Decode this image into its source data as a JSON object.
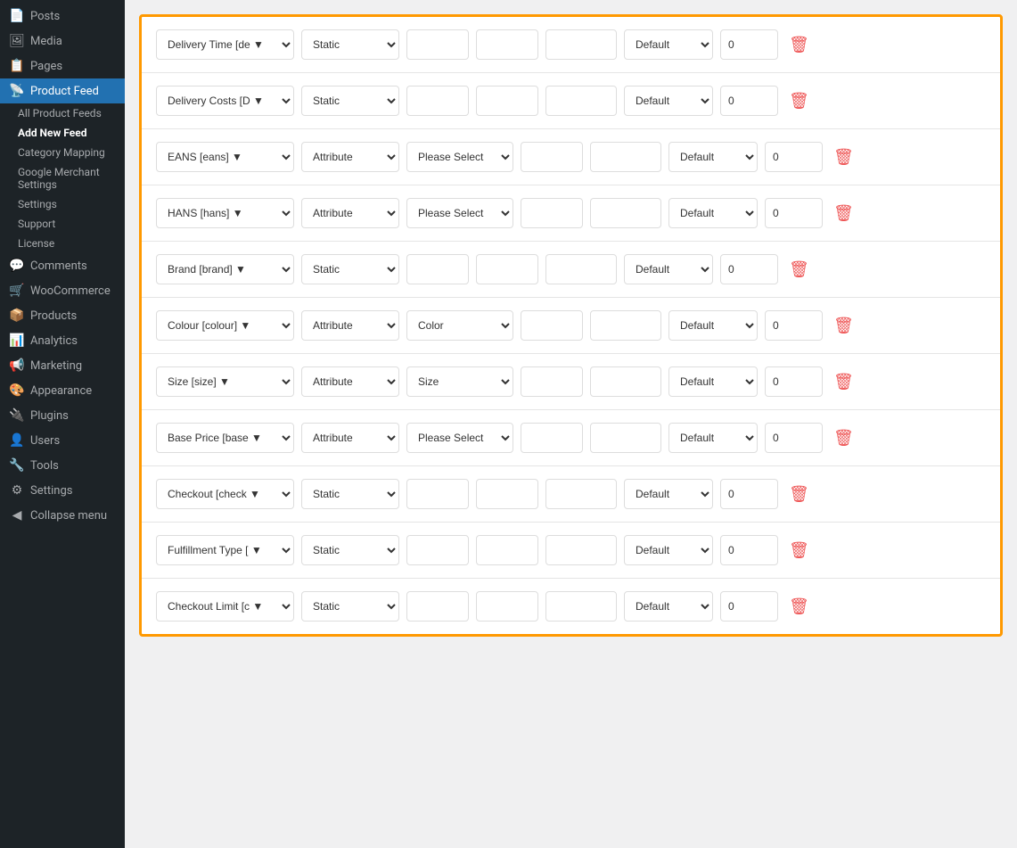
{
  "sidebar": {
    "items": [
      {
        "id": "posts",
        "label": "Posts",
        "icon": "📄"
      },
      {
        "id": "media",
        "label": "Media",
        "icon": "🖼"
      },
      {
        "id": "pages",
        "label": "Pages",
        "icon": "📋"
      },
      {
        "id": "product-feed",
        "label": "Product Feed",
        "icon": "📡",
        "active": true
      },
      {
        "id": "comments",
        "label": "Comments",
        "icon": "💬"
      },
      {
        "id": "woocommerce",
        "label": "WooCommerce",
        "icon": "🛒"
      },
      {
        "id": "products",
        "label": "Products",
        "icon": "📦"
      },
      {
        "id": "analytics",
        "label": "Analytics",
        "icon": "📊"
      },
      {
        "id": "marketing",
        "label": "Marketing",
        "icon": "📢"
      },
      {
        "id": "appearance",
        "label": "Appearance",
        "icon": "🎨"
      },
      {
        "id": "plugins",
        "label": "Plugins",
        "icon": "🔌"
      },
      {
        "id": "users",
        "label": "Users",
        "icon": "👤"
      },
      {
        "id": "tools",
        "label": "Tools",
        "icon": "🔧"
      },
      {
        "id": "settings",
        "label": "Settings",
        "icon": "⚙"
      },
      {
        "id": "collapse",
        "label": "Collapse menu",
        "icon": "◀"
      }
    ],
    "submenu": [
      {
        "id": "all-feeds",
        "label": "All Product Feeds"
      },
      {
        "id": "add-new",
        "label": "Add New Feed",
        "bold": true
      },
      {
        "id": "category",
        "label": "Category Mapping"
      },
      {
        "id": "google",
        "label": "Google Merchant Settings"
      },
      {
        "id": "settings-sub",
        "label": "Settings"
      },
      {
        "id": "support",
        "label": "Support"
      },
      {
        "id": "license",
        "label": "License"
      }
    ]
  },
  "rows": [
    {
      "id": "delivery-time",
      "fieldName": "Delivery Time [de",
      "type": "Static",
      "valueSelect": "",
      "input1": "",
      "input2": "",
      "default": "Default",
      "number": "0"
    },
    {
      "id": "delivery-costs",
      "fieldName": "Delivery Costs [D",
      "type": "Static",
      "valueSelect": "",
      "input1": "",
      "input2": "",
      "default": "Default",
      "number": "0"
    },
    {
      "id": "eans",
      "fieldName": "EANS [eans]",
      "type": "Attribute",
      "valueSelect": "Please Select",
      "input1": "",
      "input2": "",
      "default": "Default",
      "number": "0"
    },
    {
      "id": "hans",
      "fieldName": "HANS [hans]",
      "type": "Attribute",
      "valueSelect": "Please Select",
      "input1": "",
      "input2": "",
      "default": "Default",
      "number": "0"
    },
    {
      "id": "brand",
      "fieldName": "Brand [brand]",
      "type": "Static",
      "valueSelect": "",
      "input1": "",
      "input2": "",
      "default": "Default",
      "number": "0"
    },
    {
      "id": "colour",
      "fieldName": "Colour [colour]",
      "type": "Attribute",
      "valueSelect": "Color",
      "input1": "",
      "input2": "",
      "default": "Default",
      "number": "0"
    },
    {
      "id": "size",
      "fieldName": "Size [size]",
      "type": "Attribute",
      "valueSelect": "Size",
      "input1": "",
      "input2": "",
      "default": "Default",
      "number": "0"
    },
    {
      "id": "base-price",
      "fieldName": "Base Price [base",
      "type": "Attribute",
      "valueSelect": "Please Select",
      "input1": "",
      "input2": "",
      "default": "Default",
      "number": "0"
    },
    {
      "id": "checkout",
      "fieldName": "Checkout [check",
      "type": "Static",
      "valueSelect": "",
      "input1": "",
      "input2": "",
      "default": "Default",
      "number": "0"
    },
    {
      "id": "fulfillment",
      "fieldName": "Fulfillment Type [",
      "type": "Static",
      "valueSelect": "",
      "input1": "",
      "input2": "",
      "default": "Default",
      "number": "0"
    },
    {
      "id": "checkout-limit",
      "fieldName": "Checkout Limit [c",
      "type": "Static",
      "valueSelect": "",
      "input1": "",
      "input2": "",
      "default": "Default",
      "number": "0"
    }
  ],
  "labels": {
    "delete": "🗑",
    "all_feeds": "All Product Feeds",
    "add_new_feed": "Add New Feed",
    "category_mapping": "Category Mapping",
    "google_merchant": "Google Merchant Settings",
    "settings": "Settings",
    "support": "Support",
    "license": "License"
  }
}
